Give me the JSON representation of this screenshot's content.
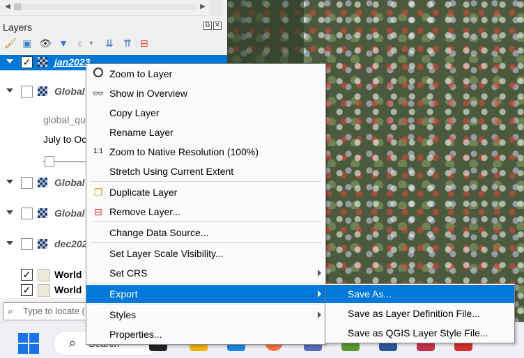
{
  "layers_panel": {
    "title": "Layers",
    "panel_buttons": [
      "⧉",
      "✕"
    ],
    "layers": [
      {
        "name": "jan2023",
        "checked": true,
        "selected": true,
        "icon": "raster-layer-icon"
      },
      {
        "name": "Global",
        "checked": false,
        "selected": false,
        "icon": "raster-layer-icon"
      },
      {
        "name": "Global",
        "checked": false,
        "selected": false,
        "icon": "raster-layer-icon"
      },
      {
        "name": "Global",
        "checked": false,
        "selected": false,
        "icon": "raster-layer-icon"
      },
      {
        "name": "dec202",
        "checked": false,
        "selected": false,
        "icon": "raster-layer-icon"
      },
      {
        "name": "World",
        "checked": true,
        "selected": false,
        "icon": "vector-layer-icon"
      },
      {
        "name": "World",
        "checked": true,
        "selected": false,
        "icon": "vector-layer-icon"
      }
    ],
    "sub_label_1": "global_qu",
    "sub_label_2": "July to Oc",
    "checkmark": "✓"
  },
  "locator": {
    "placeholder": "Type to locate ("
  },
  "context_menu": {
    "items": [
      {
        "label": "Zoom to Layer",
        "icon": "zoom-to-layer-icon"
      },
      {
        "label": "Show in Overview",
        "icon": "show-in-overview-icon"
      },
      {
        "label": "Copy Layer",
        "icon": ""
      },
      {
        "label": "Rename Layer",
        "icon": ""
      },
      {
        "label": "Zoom to Native Resolution (100%)",
        "icon": "native-resolution-icon"
      },
      {
        "label": "Stretch Using Current Extent",
        "icon": ""
      },
      {
        "label": "Duplicate Layer",
        "icon": "duplicate-layer-icon"
      },
      {
        "label": "Remove Layer...",
        "icon": "remove-layer-icon"
      },
      {
        "label": "Change Data Source...",
        "icon": ""
      },
      {
        "label": "Set Layer Scale Visibility...",
        "icon": ""
      },
      {
        "label": "Set CRS",
        "icon": "",
        "submenu": true
      },
      {
        "label": "Export",
        "icon": "",
        "submenu": true,
        "highlighted": true
      },
      {
        "label": "Styles",
        "icon": "",
        "submenu": true
      },
      {
        "label": "Properties...",
        "icon": ""
      }
    ]
  },
  "export_submenu": {
    "items": [
      {
        "label": "Save As...",
        "highlighted": true
      },
      {
        "label": "Save as Layer Definition File..."
      },
      {
        "label": "Save as QGIS Layer Style File..."
      }
    ]
  },
  "taskbar": {
    "search_label": "Search"
  },
  "colors": {
    "selection": "#0078d7",
    "menu_bg": "#fbfbfb"
  }
}
